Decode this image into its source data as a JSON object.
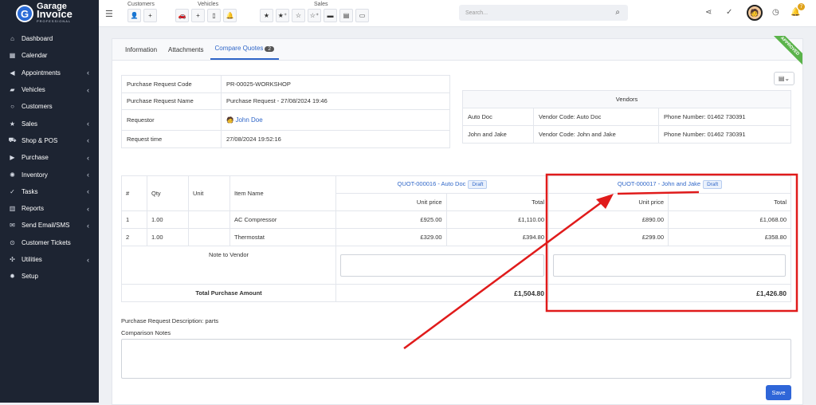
{
  "brand": {
    "line1": "Garage",
    "line2": "Invoice",
    "line3": "PROFESSIONAL"
  },
  "sidebar": {
    "items": [
      {
        "label": "Dashboard",
        "icon": "home-icon",
        "chev": false
      },
      {
        "label": "Calendar",
        "icon": "calendar-icon",
        "chev": false
      },
      {
        "label": "Appointments",
        "icon": "megaphone-icon",
        "chev": true
      },
      {
        "label": "Vehicles",
        "icon": "car-icon",
        "chev": true
      },
      {
        "label": "Customers",
        "icon": "user-icon",
        "chev": false
      },
      {
        "label": "Sales",
        "icon": "star-icon",
        "chev": true
      },
      {
        "label": "Shop & POS",
        "icon": "cart-icon",
        "chev": true
      },
      {
        "label": "Purchase",
        "icon": "truck-icon",
        "chev": true
      },
      {
        "label": "Inventory",
        "icon": "gear-icon",
        "chev": true
      },
      {
        "label": "Tasks",
        "icon": "check-circle-icon",
        "chev": true
      },
      {
        "label": "Reports",
        "icon": "report-icon",
        "chev": true
      },
      {
        "label": "Send Email/SMS",
        "icon": "mail-icon",
        "chev": true
      },
      {
        "label": "Customer Tickets",
        "icon": "ticket-icon",
        "chev": false
      },
      {
        "label": "Utilities",
        "icon": "tools-icon",
        "chev": true
      },
      {
        "label": "Setup",
        "icon": "cog-icon",
        "chev": false
      }
    ]
  },
  "topbar": {
    "groups": {
      "customers": "Customers",
      "vehicles": "Vehicles",
      "sales": "Sales"
    },
    "search_placeholder": "Search...",
    "notification_count": "7"
  },
  "tabs": [
    {
      "label": "Information"
    },
    {
      "label": "Attachments"
    },
    {
      "label": "Compare Quotes",
      "count": "2"
    }
  ],
  "ribbon": "APPROVED",
  "info": [
    {
      "k": "Purchase Request Code",
      "v": "PR-00025-WORKSHOP"
    },
    {
      "k": "Purchase Request Name",
      "v": "Purchase Request - 27/08/2024 19:46"
    },
    {
      "k": "Requestor",
      "v": "John Doe"
    },
    {
      "k": "Request time",
      "v": "27/08/2024 19:52:16"
    }
  ],
  "vendors": {
    "title": "Vendors",
    "rows": [
      {
        "name": "Auto Doc",
        "code": "Vendor Code: Auto Doc",
        "phone": "Phone Number: 01462 730391"
      },
      {
        "name": "John and Jake",
        "code": "Vendor Code: John and Jake",
        "phone": "Phone Number: 01462 730391"
      }
    ]
  },
  "quotes": {
    "headers": {
      "num": "#",
      "qty": "Qty",
      "unit": "Unit",
      "item": "Item Name",
      "unit_price": "Unit price",
      "total": "Total"
    },
    "q1": {
      "label": "QUOT-000016 - Auto Doc",
      "status": "Draft"
    },
    "q2": {
      "label": "QUOT-000017 - John and Jake",
      "status": "Draft"
    },
    "rows": [
      {
        "n": "1",
        "qty": "1.00",
        "unit": "",
        "item": "AC Compressor",
        "q1p": "£925.00",
        "q1t": "£1,110.00",
        "q2p": "£890.00",
        "q2t": "£1,068.00"
      },
      {
        "n": "2",
        "qty": "1.00",
        "unit": "",
        "item": "Thermostat",
        "q1p": "£329.00",
        "q1t": "£394.80",
        "q2p": "£299.00",
        "q2t": "£358.80"
      }
    ],
    "note_label": "Note to Vendor",
    "total_label": "Total Purchase Amount",
    "q1_total": "£1,504.80",
    "q2_total": "£1,426.80"
  },
  "description": {
    "label": "Purchase Request Description:",
    "value": "parts"
  },
  "comparison_label": "Comparison Notes",
  "save_label": "Save",
  "colors": {
    "accent": "#2f66c8",
    "sidebar": "#1d2432",
    "highlight": "#e01b1b",
    "approved": "#5ab34a"
  }
}
